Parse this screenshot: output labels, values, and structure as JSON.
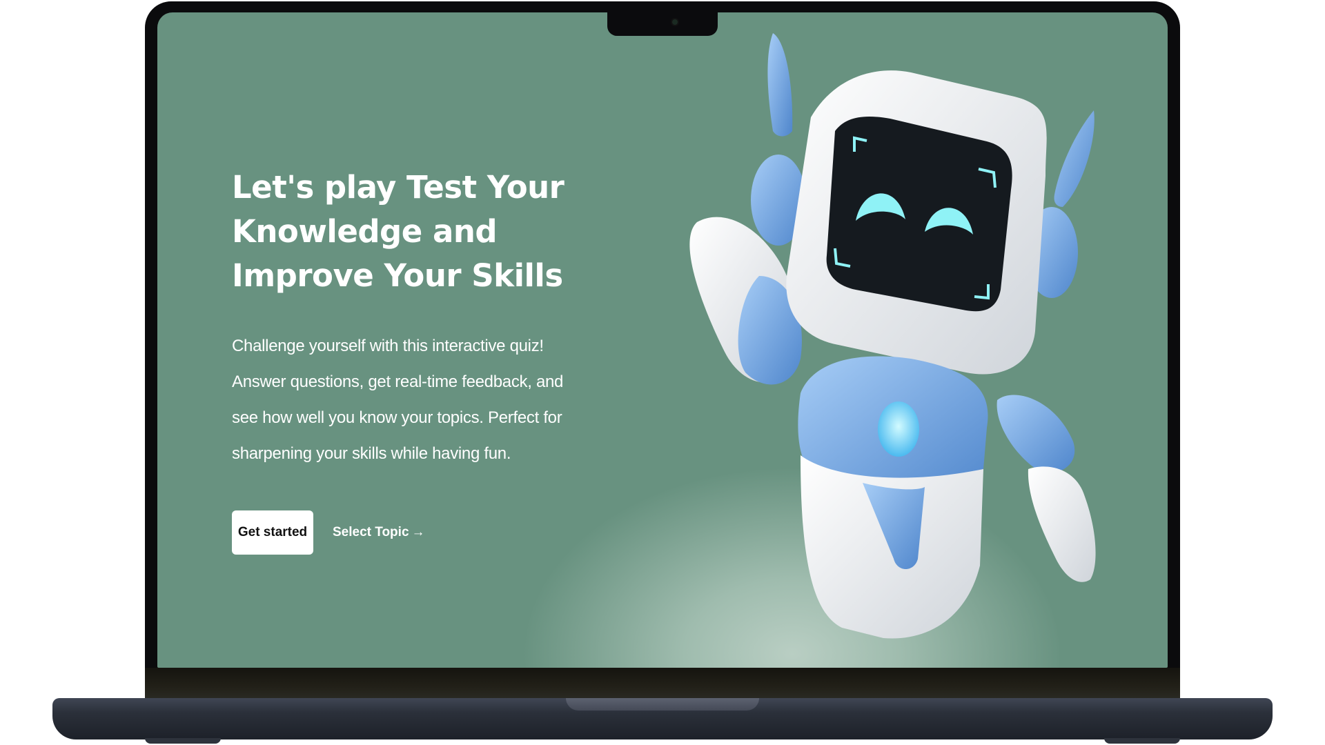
{
  "hero": {
    "title": "Let's play Test Your Knowledge and Improve Your Skills",
    "description": "Challenge yourself with this interactive quiz! Answer questions, get real-time feedback, and see how well you know your topics. Perfect for sharpening your skills while having fun.",
    "primary_button_label": "Get started",
    "secondary_link_label": "Select Topic",
    "secondary_link_arrow": "→"
  },
  "colors": {
    "screen_background": "#689280",
    "text": "#ffffff",
    "button_background": "#ffffff",
    "button_text": "#111111",
    "robot_body": "#e9ecef",
    "robot_accent": "#6aa0e0",
    "robot_face": "#8ff2f6"
  },
  "icons": {
    "robot_illustration": "robot-mascot",
    "link_arrow": "right-arrow-icon"
  }
}
